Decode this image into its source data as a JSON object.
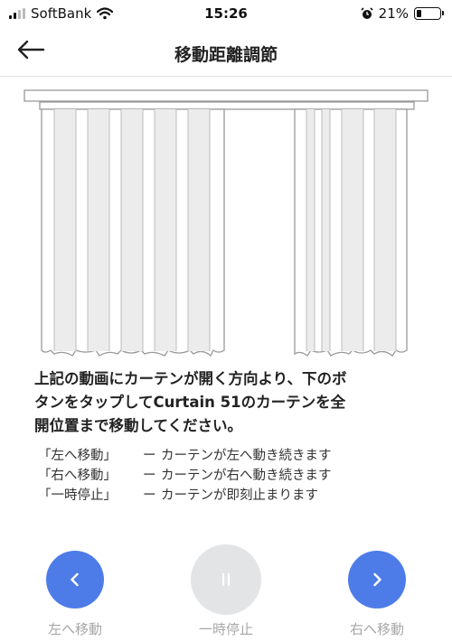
{
  "status_bar": {
    "carrier": "SoftBank",
    "time": "15:26",
    "battery_percent": "21%",
    "battery_level": 0.21
  },
  "nav": {
    "title": "移動距離調節"
  },
  "instruction": {
    "line1": "上記の動画にカーテンが開く方向より、下のボ",
    "line2": "タンをタップしてCurtain 51のカーテンを全",
    "line3": "開位置まで移動してください。"
  },
  "legend": [
    {
      "key": "「左へ移動」",
      "dash": "ー",
      "value": "カーテンが左へ動き続きます"
    },
    {
      "key": "「右へ移動」",
      "dash": "ー",
      "value": "カーテンが右へ動き続きます"
    },
    {
      "key": "「一時停止」",
      "dash": "ー",
      "value": "カーテンが即刻止まります"
    }
  ],
  "controls": {
    "left_label": "左へ移動",
    "pause_label": "一時停止",
    "right_label": "右へ移動"
  },
  "colors": {
    "accent": "#4d7ce8",
    "disabled": "#e3e4e6",
    "label_gray": "#a7a7a7"
  }
}
